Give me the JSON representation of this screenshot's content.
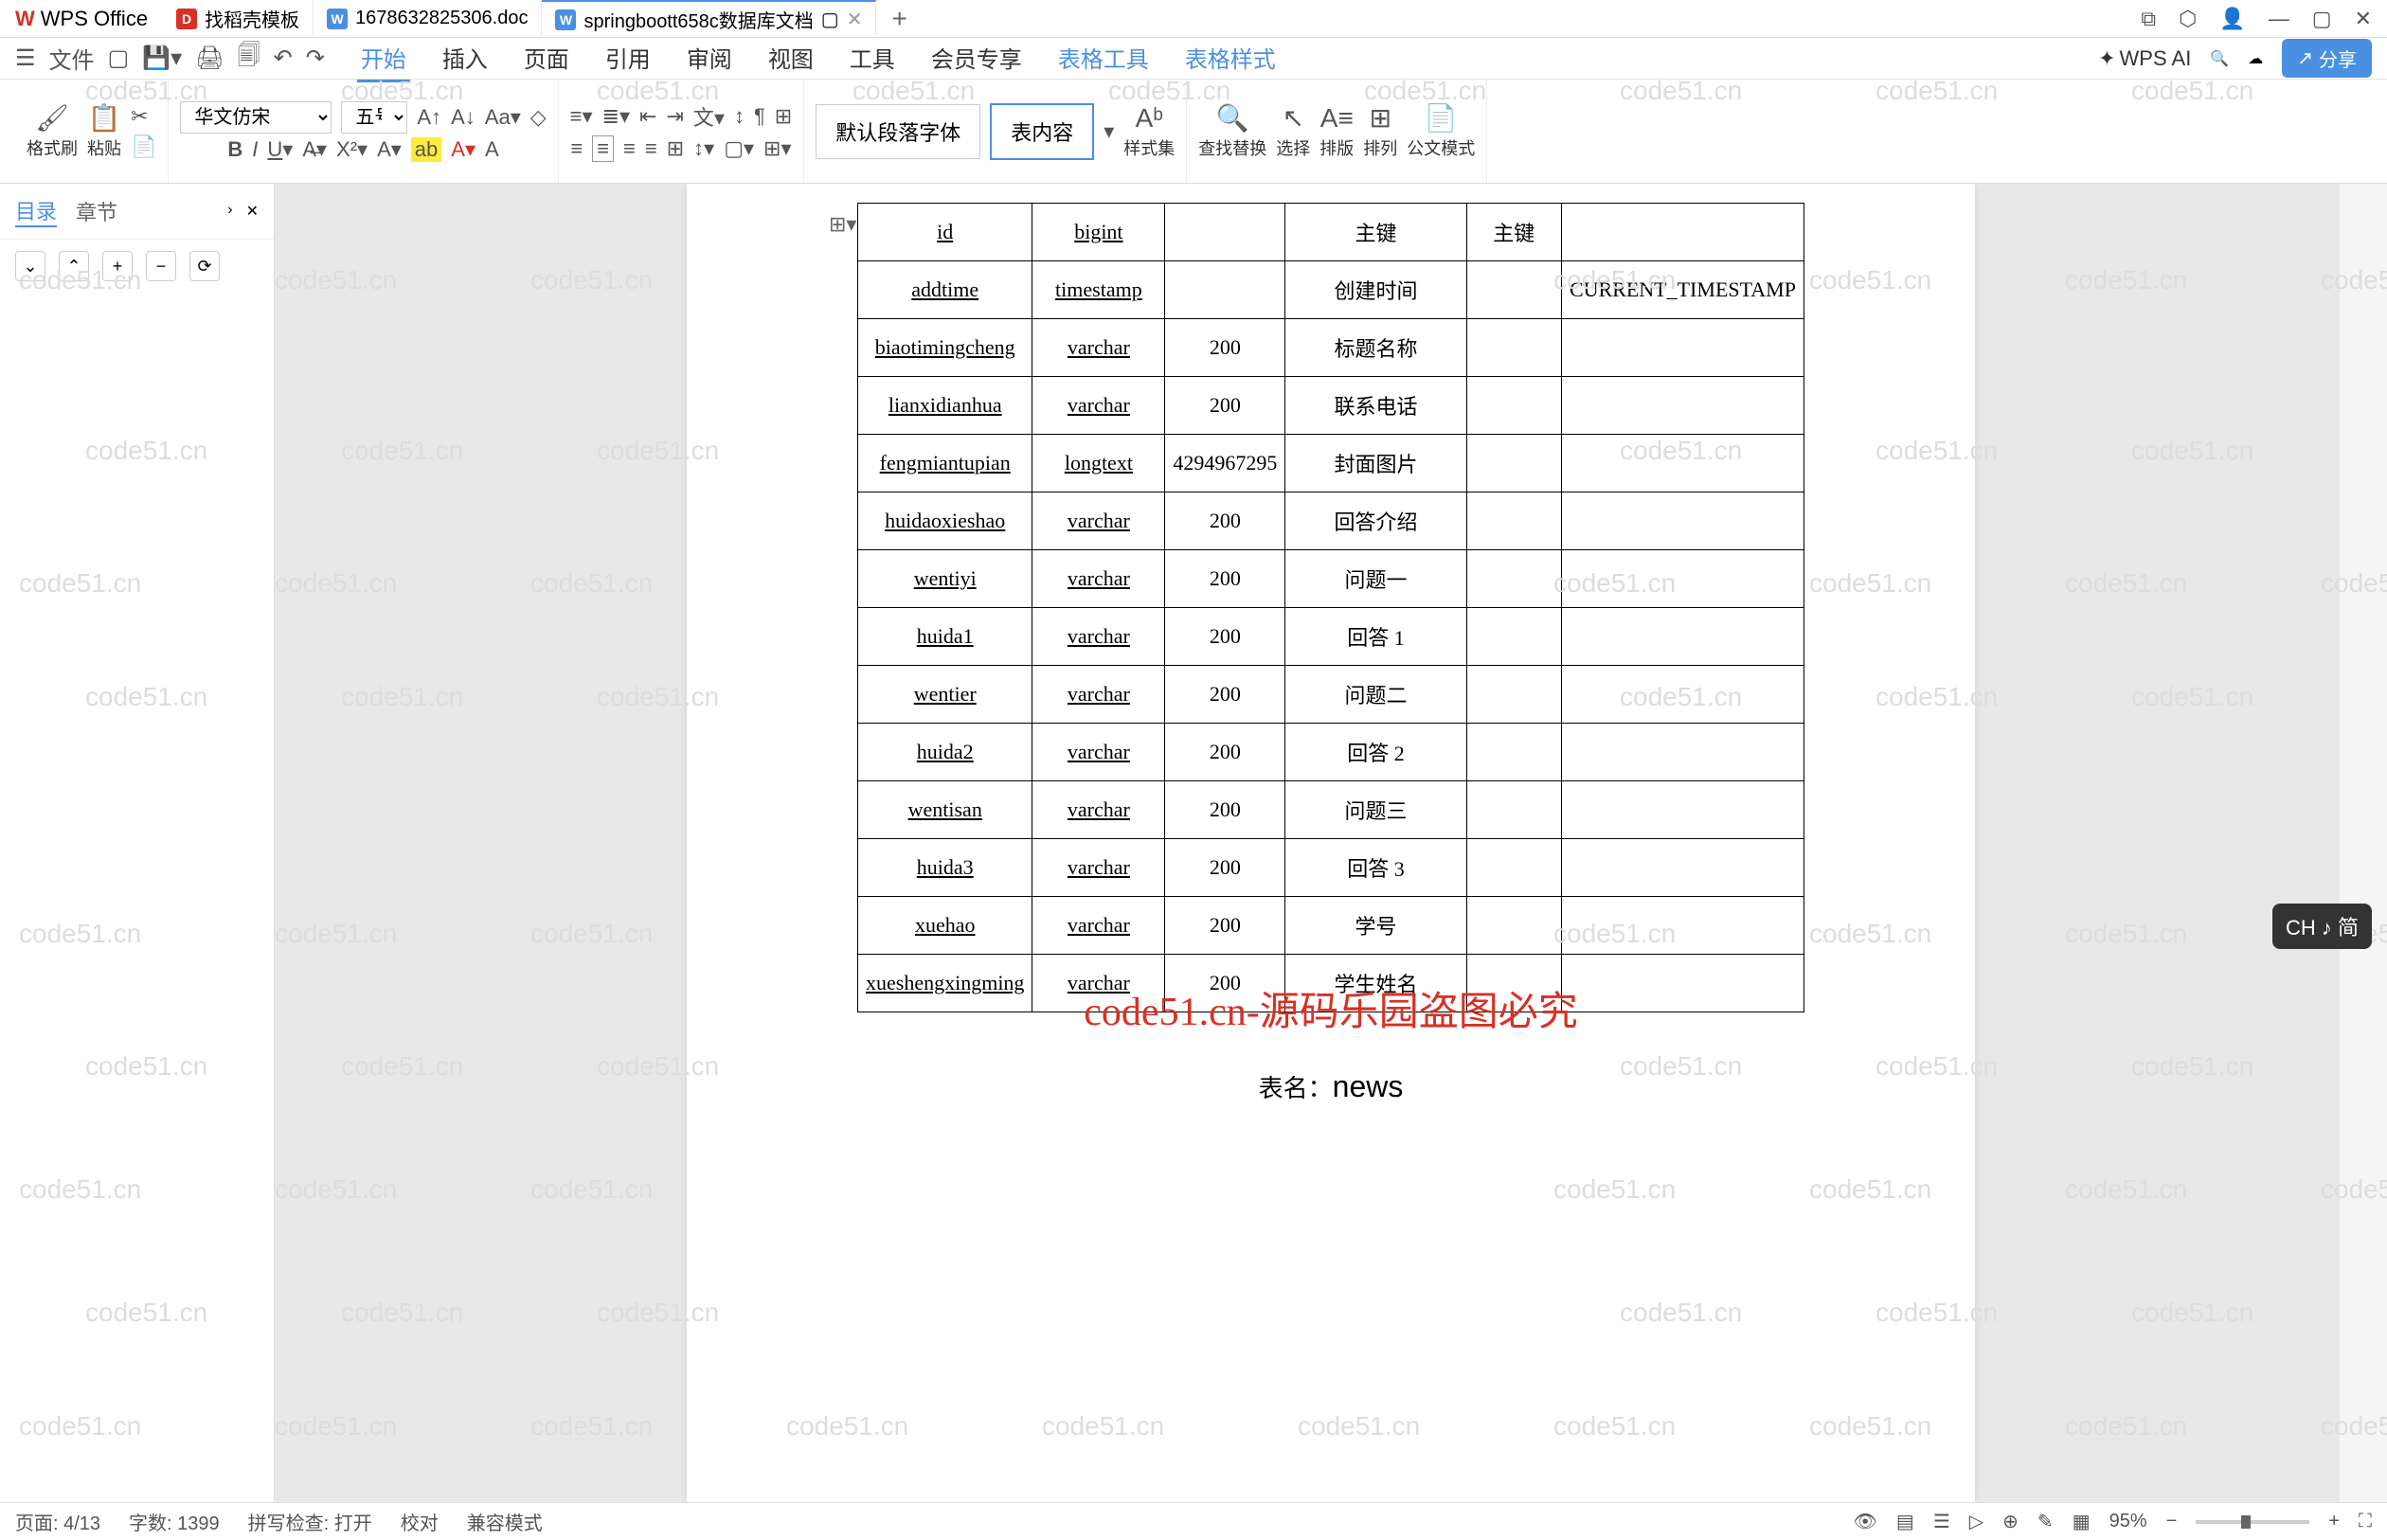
{
  "app": {
    "name": "WPS Office"
  },
  "tabs": [
    {
      "icon": "red",
      "iconText": "D",
      "label": "找稻壳模板"
    },
    {
      "icon": "blue",
      "iconText": "W",
      "label": "1678632825306.doc"
    },
    {
      "icon": "blue",
      "iconText": "W",
      "label": "springboott658c数据库文档",
      "active": true,
      "hasExtra": true
    }
  ],
  "menu": {
    "file": "文件",
    "items": [
      "开始",
      "插入",
      "页面",
      "引用",
      "审阅",
      "视图",
      "工具",
      "会员专享",
      "表格工具",
      "表格样式"
    ],
    "activeIndex": 0,
    "blueStart": 8,
    "wpsai": "WPS AI",
    "share": "分享"
  },
  "ribbon": {
    "formatBrush": "格式刷",
    "paste": "粘贴",
    "font": "华文仿宋",
    "fontSize": "五号",
    "styleDefault": "默认段落字体",
    "styleContent": "表内容",
    "styleSet": "样式集",
    "findReplace": "查找替换",
    "select": "选择",
    "arrange": "排版",
    "sort": "排列",
    "docMode": "公文模式"
  },
  "sidebar": {
    "tab1": "目录",
    "tab2": "章节"
  },
  "table": {
    "rows": [
      {
        "c1": "id",
        "c2": "bigint",
        "c3": "",
        "c4": "主键",
        "c5": "主键",
        "c6": ""
      },
      {
        "c1": "addtime",
        "c2": "timestamp",
        "c3": "",
        "c4": "创建时间",
        "c5": "",
        "c6": "CURRENT_TIMESTAMP"
      },
      {
        "c1": "biaotimingcheng",
        "c2": "varchar",
        "c3": "200",
        "c4": "标题名称",
        "c5": "",
        "c6": ""
      },
      {
        "c1": "lianxidianhua",
        "c2": "varchar",
        "c3": "200",
        "c4": "联系电话",
        "c5": "",
        "c6": ""
      },
      {
        "c1": "fengmiantupian",
        "c2": "longtext",
        "c3": "4294967295",
        "c4": "封面图片",
        "c5": "",
        "c6": ""
      },
      {
        "c1": "huidaoxieshao",
        "c2": "varchar",
        "c3": "200",
        "c4": "回答介绍",
        "c5": "",
        "c6": ""
      },
      {
        "c1": "wentiyi",
        "c2": "varchar",
        "c3": "200",
        "c4": "问题一",
        "c5": "",
        "c6": ""
      },
      {
        "c1": "huida1",
        "c2": "varchar",
        "c3": "200",
        "c4": "回答 1",
        "c5": "",
        "c6": ""
      },
      {
        "c1": "wentier",
        "c2": "varchar",
        "c3": "200",
        "c4": "问题二",
        "c5": "",
        "c6": ""
      },
      {
        "c1": "huida2",
        "c2": "varchar",
        "c3": "200",
        "c4": "回答 2",
        "c5": "",
        "c6": ""
      },
      {
        "c1": "wentisan",
        "c2": "varchar",
        "c3": "200",
        "c4": "问题三",
        "c5": "",
        "c6": ""
      },
      {
        "c1": "huida3",
        "c2": "varchar",
        "c3": "200",
        "c4": "回答 3",
        "c5": "",
        "c6": ""
      },
      {
        "c1": "xuehao",
        "c2": "varchar",
        "c3": "200",
        "c4": "学号",
        "c5": "",
        "c6": ""
      },
      {
        "c1": "xueshengxingming",
        "c2": "varchar",
        "c3": "200",
        "c4": "学生姓名",
        "c5": "",
        "c6": ""
      }
    ],
    "footerLabel": "表名：",
    "footerValue": "news"
  },
  "watermarkText": "code51.cn",
  "watermarkCenter": "code51.cn-源码乐园盗图必究",
  "ime": "CH ♪ 简",
  "status": {
    "page": "页面: 4/13",
    "words": "字数: 1399",
    "spell": "拼写检查: 打开",
    "proofread": "校对",
    "compat": "兼容模式",
    "zoom": "95%"
  }
}
